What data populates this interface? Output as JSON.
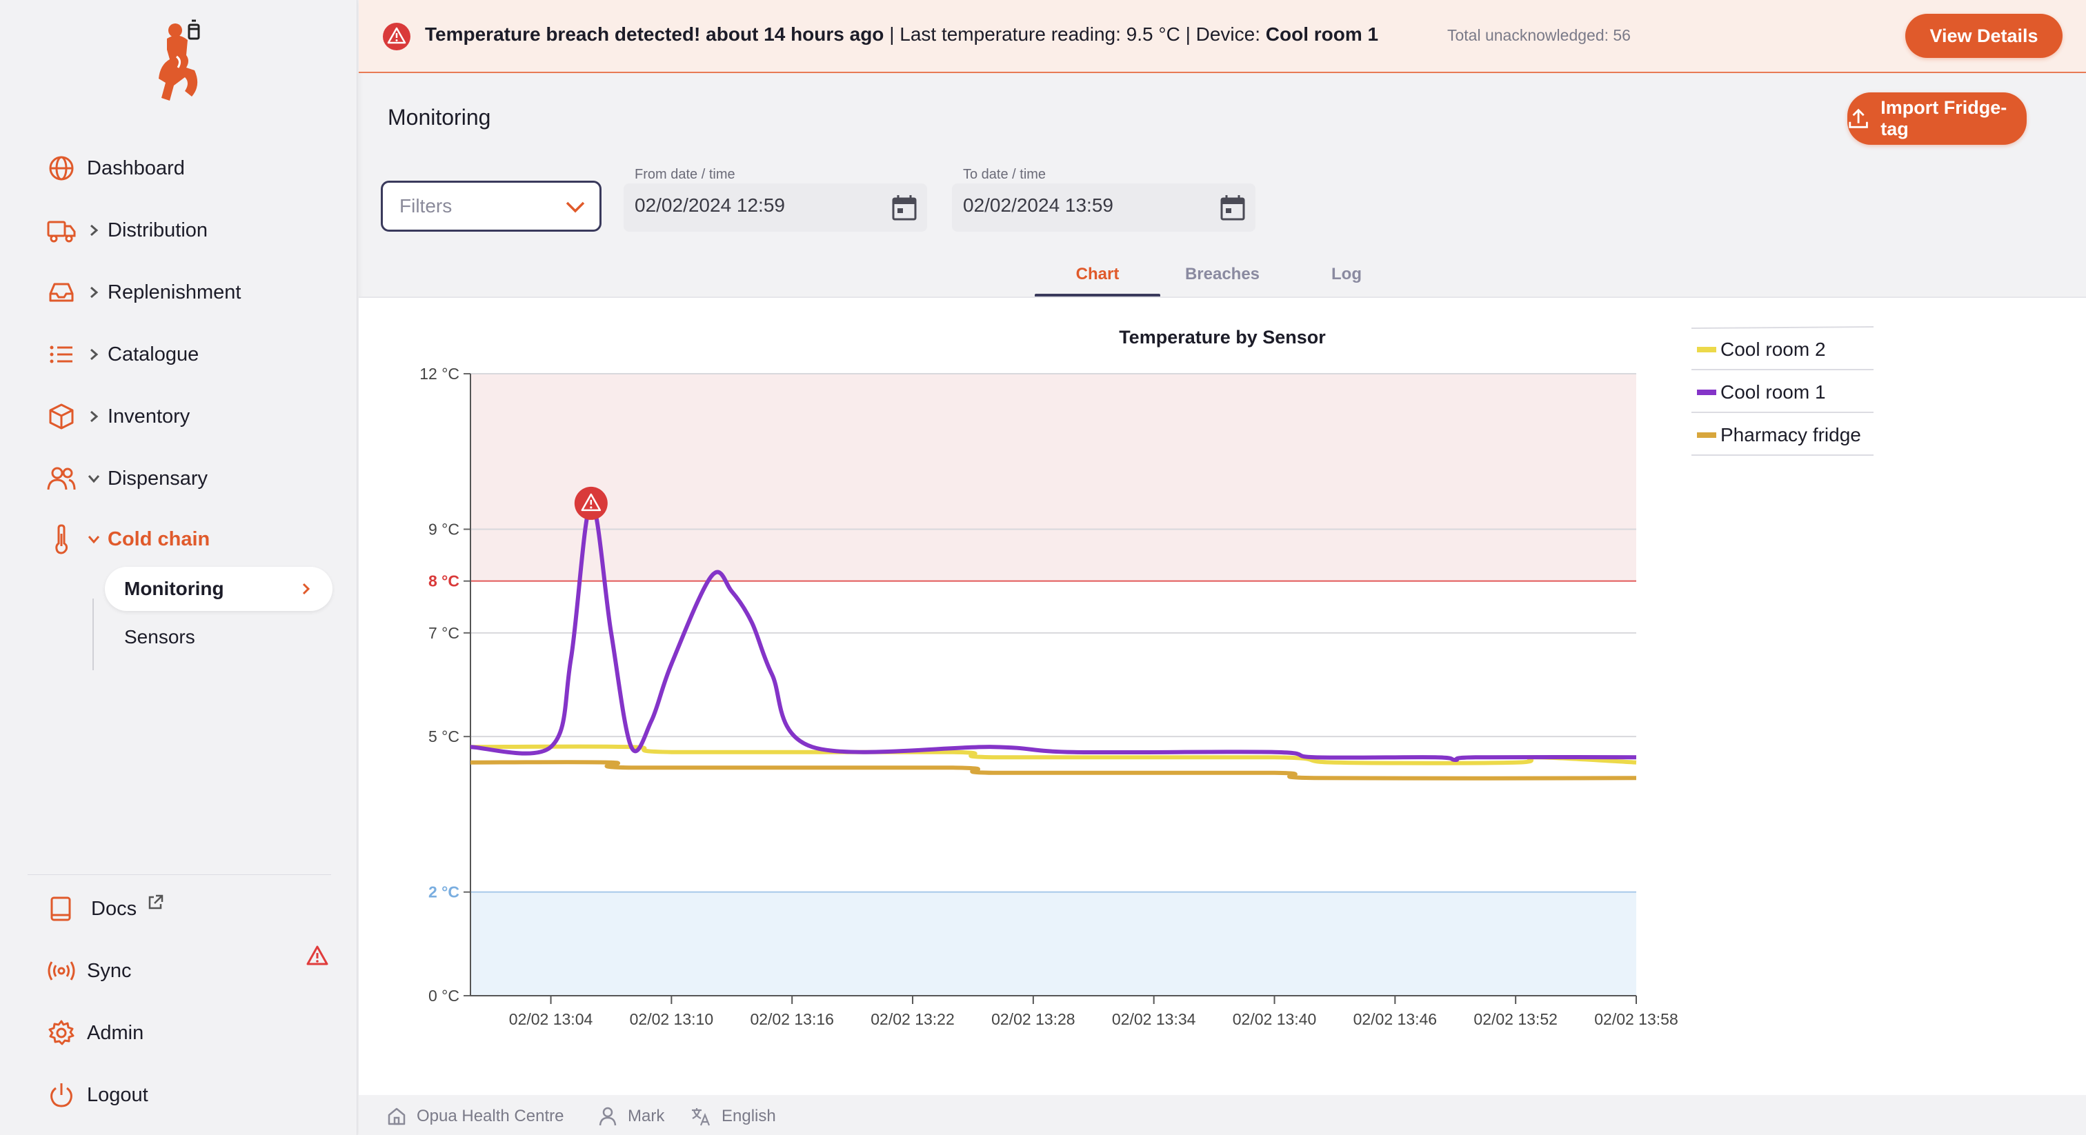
{
  "sidebar": {
    "items": [
      {
        "label": "Dashboard",
        "icon": "globe-icon"
      },
      {
        "label": "Distribution",
        "icon": "truck-icon"
      },
      {
        "label": "Replenishment",
        "icon": "inbox-icon"
      },
      {
        "label": "Catalogue",
        "icon": "list-icon"
      },
      {
        "label": "Inventory",
        "icon": "box-icon"
      },
      {
        "label": "Dispensary",
        "icon": "users-icon"
      },
      {
        "label": "Cold chain",
        "icon": "thermometer-icon"
      }
    ],
    "subitems": [
      {
        "label": "Monitoring"
      },
      {
        "label": "Sensors"
      }
    ],
    "bottom": [
      {
        "label": "Docs",
        "icon": "book-icon"
      },
      {
        "label": "Sync",
        "icon": "sync-icon"
      },
      {
        "label": "Admin",
        "icon": "gear-icon"
      },
      {
        "label": "Logout",
        "icon": "power-icon"
      }
    ]
  },
  "alert": {
    "text_bold": "Temperature breach detected! about 14 hours ago",
    "text_reading": " | Last temperature reading: 9.5 °C | Device: ",
    "device": "Cool room 1",
    "total": "Total unacknowledged: 56",
    "button": "View Details"
  },
  "header": {
    "title": "Monitoring",
    "import_button": "Import Fridge-tag",
    "filters_placeholder": "Filters",
    "from_label": "From date / time",
    "from_value": "02/02/2024 12:59",
    "to_label": "To date / time",
    "to_value": "02/02/2024 13:59",
    "tabs": [
      "Chart",
      "Breaches",
      "Log"
    ]
  },
  "colors": {
    "accent": "#e05a2b",
    "cool_room_2": "#ecd94a",
    "cool_room_1": "#8434c8",
    "pharmacy_fridge": "#d8a63c",
    "breach_zone": "#f9ecec",
    "cold_zone": "#eaf3fb"
  },
  "chart_data": {
    "type": "line",
    "title": "Temperature by Sensor",
    "y_unit": "°C",
    "ylim": [
      0,
      12
    ],
    "y_ticks": [
      12,
      9,
      8,
      7,
      5,
      2,
      0
    ],
    "high_threshold": 8,
    "low_threshold": 2,
    "x_tick_labels": [
      "02/02 13:04",
      "02/02 13:10",
      "02/02 13:16",
      "02/02 13:22",
      "02/02 13:28",
      "02/02 13:34",
      "02/02 13:40",
      "02/02 13:46",
      "02/02 13:52",
      "02/02 13:58"
    ],
    "x_minutes_range": [
      "13:00",
      "13:58"
    ],
    "legend_position": "right",
    "breach_marker": {
      "time": "13:06",
      "value": 9.5,
      "series": "Cool room 1"
    },
    "series": [
      {
        "name": "Cool room 2",
        "color": "#ecd94a",
        "points": [
          [
            "13:00",
            4.8
          ],
          [
            "13:08",
            4.8
          ],
          [
            "13:10",
            4.7
          ],
          [
            "13:24",
            4.7
          ],
          [
            "13:26",
            4.6
          ],
          [
            "13:40",
            4.6
          ],
          [
            "13:43",
            4.5
          ],
          [
            "13:52",
            4.5
          ],
          [
            "13:53",
            4.6
          ],
          [
            "13:58",
            4.5
          ]
        ]
      },
      {
        "name": "Cool room 1",
        "color": "#8434c8",
        "points": [
          [
            "13:00",
            4.8
          ],
          [
            "13:04",
            4.8
          ],
          [
            "13:05",
            6.5
          ],
          [
            "13:06",
            9.5
          ],
          [
            "13:07",
            7.0
          ],
          [
            "13:08",
            4.8
          ],
          [
            "13:09",
            5.3
          ],
          [
            "13:10",
            6.4
          ],
          [
            "13:12",
            8.1
          ],
          [
            "13:13",
            7.8
          ],
          [
            "13:14",
            7.2
          ],
          [
            "13:15",
            6.2
          ],
          [
            "13:17",
            4.8
          ],
          [
            "13:26",
            4.8
          ],
          [
            "13:30",
            4.7
          ],
          [
            "13:40",
            4.7
          ],
          [
            "13:42",
            4.6
          ],
          [
            "13:48",
            4.6
          ],
          [
            "13:49",
            4.55
          ],
          [
            "13:50",
            4.6
          ],
          [
            "13:58",
            4.6
          ]
        ]
      },
      {
        "name": "Pharmacy fridge",
        "color": "#d8a63c",
        "points": [
          [
            "13:00",
            4.5
          ],
          [
            "13:07",
            4.5
          ],
          [
            "13:08",
            4.4
          ],
          [
            "13:24",
            4.4
          ],
          [
            "13:26",
            4.3
          ],
          [
            "13:40",
            4.3
          ],
          [
            "13:42",
            4.2
          ],
          [
            "13:58",
            4.2
          ]
        ]
      }
    ]
  },
  "footer": {
    "store": "Opua Health Centre",
    "user": "Mark",
    "language": "English"
  }
}
